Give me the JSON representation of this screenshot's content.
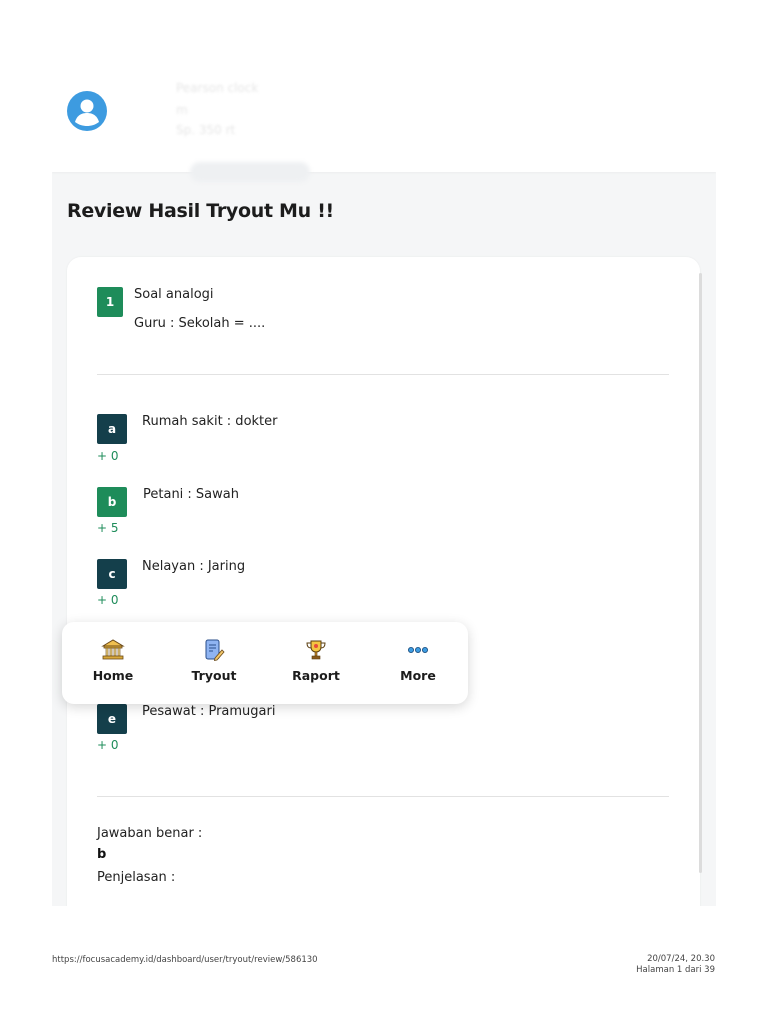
{
  "header": {
    "blurred_lines": [
      "Pearson clock",
      "m",
      "Sp. 350 rt"
    ]
  },
  "page": {
    "title": "Review Hasil Tryout Mu !!"
  },
  "question": {
    "number": "1",
    "title": "Soal analogi",
    "text": "Guru : Sekolah = ...."
  },
  "options": [
    {
      "letter": "a",
      "text": "Rumah sakit : dokter",
      "score": "+ 0",
      "correct": false
    },
    {
      "letter": "b",
      "text": "Petani : Sawah",
      "score": "+ 5",
      "correct": true
    },
    {
      "letter": "c",
      "text": "Nelayan : Jaring",
      "score": "+ 0",
      "correct": false
    },
    {
      "letter": "e",
      "text": "Pesawat : Pramugari",
      "score": "+ 0",
      "correct": false
    }
  ],
  "answer": {
    "label": "Jawaban benar :",
    "value": "b",
    "explanation_label": "Penjelasan :"
  },
  "nav": {
    "items": [
      {
        "label": "Home",
        "icon": "bank-icon"
      },
      {
        "label": "Tryout",
        "icon": "document-edit-icon"
      },
      {
        "label": "Raport",
        "icon": "trophy-icon"
      },
      {
        "label": "More",
        "icon": "more-dots-icon"
      }
    ]
  },
  "footer": {
    "url": "https://focusacademy.id/dashboard/user/tryout/review/586130",
    "datetime": "20/07/24, 20.30",
    "page": "Halaman 1 dari 39"
  },
  "colors": {
    "correct_green": "#1e8c5a",
    "option_dark": "#143f4b",
    "avatar_blue": "#3d9be0"
  }
}
